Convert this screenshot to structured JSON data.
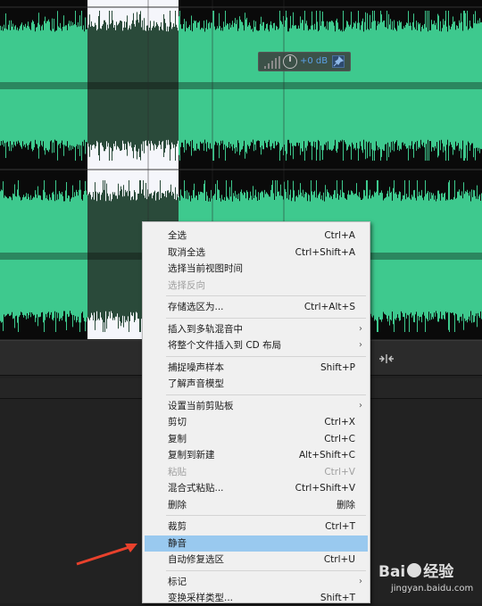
{
  "colors": {
    "waveform": "#3ec98e",
    "selection_bg": "#f5f6fb",
    "selection_wave": "#2a4a3a",
    "highlight": "#99c9ef",
    "arrow": "#e8412c"
  },
  "hud": {
    "gain": "+0 dB",
    "icons": [
      "level-meter-icon",
      "volume-knob-icon",
      "pin-icon"
    ]
  },
  "context_menu": {
    "items": [
      {
        "label": "全选",
        "shortcut": "Ctrl+A"
      },
      {
        "label": "取消全选",
        "shortcut": "Ctrl+Shift+A"
      },
      {
        "label": "选择当前视图时间",
        "shortcut": ""
      },
      {
        "label": "选择反向",
        "shortcut": "",
        "disabled": true
      },
      {
        "label": "存储选区为...",
        "shortcut": "Ctrl+Alt+S"
      },
      {
        "label": "插入到多轨混音中",
        "shortcut": "",
        "submenu": true
      },
      {
        "label": "将整个文件插入到 CD 布局",
        "shortcut": "",
        "submenu": true
      },
      {
        "label": "捕捉噪声样本",
        "shortcut": "Shift+P"
      },
      {
        "label": "了解声音模型",
        "shortcut": ""
      },
      {
        "label": "设置当前剪贴板",
        "shortcut": "",
        "submenu": true
      },
      {
        "label": "剪切",
        "shortcut": "Ctrl+X"
      },
      {
        "label": "复制",
        "shortcut": "Ctrl+C"
      },
      {
        "label": "复制到新建",
        "shortcut": "Alt+Shift+C"
      },
      {
        "label": "粘贴",
        "shortcut": "Ctrl+V",
        "disabled": true
      },
      {
        "label": "混合式粘贴...",
        "shortcut": "Ctrl+Shift+V"
      },
      {
        "label": "删除",
        "shortcut": "删除"
      },
      {
        "label": "裁剪",
        "shortcut": "Ctrl+T"
      },
      {
        "label": "静音",
        "shortcut": "",
        "highlighted": true
      },
      {
        "label": "自动修复选区",
        "shortcut": "Ctrl+U"
      },
      {
        "label": "标记",
        "shortcut": "",
        "submenu": true
      },
      {
        "label": "变换采样类型...",
        "shortcut": "Shift+T"
      }
    ]
  },
  "watermark": {
    "brand": "Bai",
    "brand2": "经验",
    "url": "jingyan.baidu.com"
  }
}
